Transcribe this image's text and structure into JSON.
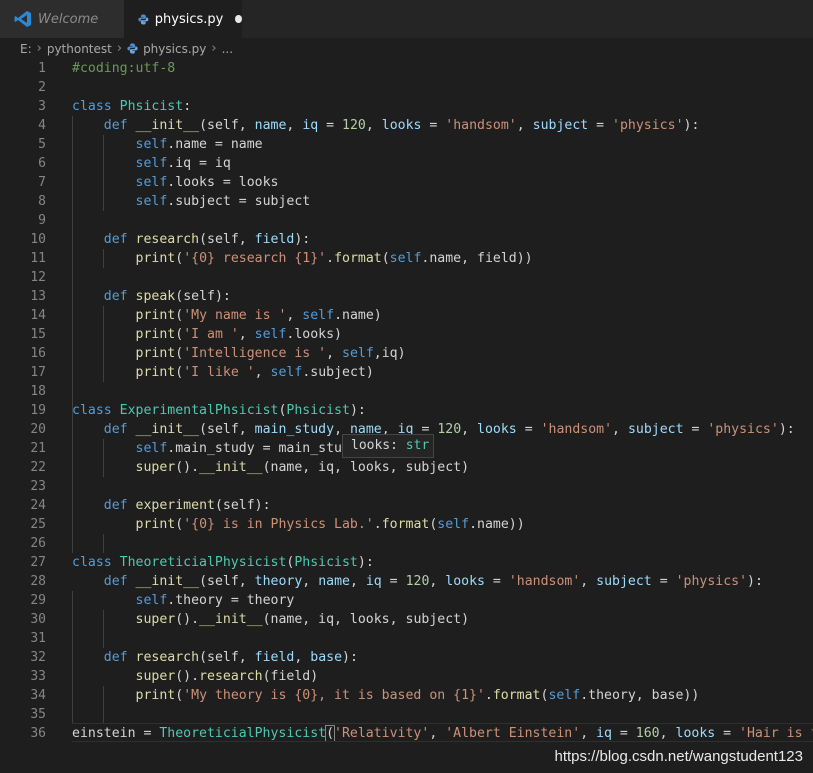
{
  "tabs": [
    {
      "label": "Welcome",
      "icon": "vscode-logo-icon",
      "active": false
    },
    {
      "label": "physics.py",
      "icon": "python-file-icon",
      "active": true,
      "dirty": true
    }
  ],
  "breadcrumb": [
    "E:",
    "pythontest",
    "physics.py",
    "..."
  ],
  "hover": {
    "name": "looks:",
    "type": "str"
  },
  "watermark": "https://blog.csdn.net/wangstudent123",
  "line_numbers": [
    "1",
    "2",
    "3",
    "4",
    "5",
    "6",
    "7",
    "8",
    "9",
    "10",
    "11",
    "12",
    "13",
    "14",
    "15",
    "16",
    "17",
    "18",
    "19",
    "20",
    "21",
    "22",
    "23",
    "24",
    "25",
    "26",
    "27",
    "28",
    "29",
    "30",
    "31",
    "32",
    "33",
    "34",
    "35",
    "36"
  ],
  "code": {
    "l1": [
      "#coding:utf-8"
    ],
    "l3": [
      "class",
      " ",
      "Phsicist",
      ":"
    ],
    "l4": [
      "def",
      " ",
      "__init__",
      "(self, ",
      "name",
      ", ",
      "iq",
      " = ",
      "120",
      ", ",
      "looks",
      " = ",
      "'handsom'",
      ", ",
      "subject",
      " = ",
      "'physics'",
      "):"
    ],
    "l5": [
      "self",
      ".name = name"
    ],
    "l6": [
      "self",
      ".iq = iq"
    ],
    "l7": [
      "self",
      ".looks = looks"
    ],
    "l8": [
      "self",
      ".subject = subject"
    ],
    "l10": [
      "def",
      " ",
      "research",
      "(self, ",
      "field",
      "):"
    ],
    "l11": [
      "print",
      "(",
      "'{0} research {1}'",
      ".",
      "format",
      "(",
      "self",
      ".name, field))"
    ],
    "l13": [
      "def",
      " ",
      "speak",
      "(self):"
    ],
    "l14": [
      "print",
      "(",
      "'My name is '",
      ", ",
      "self",
      ".name)"
    ],
    "l15": [
      "print",
      "(",
      "'I am '",
      ", ",
      "self",
      ".looks)"
    ],
    "l16": [
      "print",
      "(",
      "'Intelligence is '",
      ", ",
      "self",
      ",iq)"
    ],
    "l17": [
      "print",
      "(",
      "'I like '",
      ", ",
      "self",
      ".subject)"
    ],
    "l19": [
      "class",
      " ",
      "ExperimentalPhsicist",
      "(",
      "Phsicist",
      "):"
    ],
    "l20": [
      "def",
      " ",
      "__init__",
      "(self, ",
      "main_study",
      ", ",
      "name",
      ", ",
      "iq",
      " = ",
      "120",
      ", ",
      "looks",
      " = ",
      "'handsom'",
      ", ",
      "subject",
      " = ",
      "'physics'",
      "):"
    ],
    "l21": [
      "self",
      ".main_study = main_study"
    ],
    "l22": [
      "super",
      "().",
      "__init__",
      "(name, iq, ",
      "looks",
      ", subject)"
    ],
    "l24": [
      "def",
      " ",
      "experiment",
      "(self):"
    ],
    "l25": [
      "print",
      "(",
      "'{0} is in Physics Lab.'",
      ".",
      "format",
      "(",
      "self",
      ".name))"
    ],
    "l27": [
      "class",
      " ",
      "TheoreticialPhysicist",
      "(",
      "Phsicist",
      "):"
    ],
    "l28": [
      "def",
      " ",
      "__init__",
      "(self, ",
      "theory",
      ", ",
      "name",
      ", ",
      "iq",
      " = ",
      "120",
      ", ",
      "looks",
      " = ",
      "'handsom'",
      ", ",
      "subject",
      " = ",
      "'physics'",
      "):"
    ],
    "l29": [
      "self",
      ".theory = theory"
    ],
    "l30": [
      "super",
      "().",
      "__init__",
      "(name, iq, looks, subject)"
    ],
    "l32": [
      "def",
      " ",
      "research",
      "(self, ",
      "field",
      ", ",
      "base",
      "):"
    ],
    "l33": [
      "super",
      "().",
      "research",
      "(field)"
    ],
    "l34": [
      "print",
      "(",
      "'My theory is {0}, it is based on {1}'",
      ".",
      "format",
      "(",
      "self",
      ".theory, base))"
    ],
    "l36": [
      "einstein = ",
      "TheoreticialPhysicist",
      "(",
      "'Relativity'",
      ", ",
      "'Albert Einstein'",
      ", ",
      "iq",
      " = ",
      "160",
      ", ",
      "looks",
      " = ",
      "'Hair is few'"
    ]
  }
}
